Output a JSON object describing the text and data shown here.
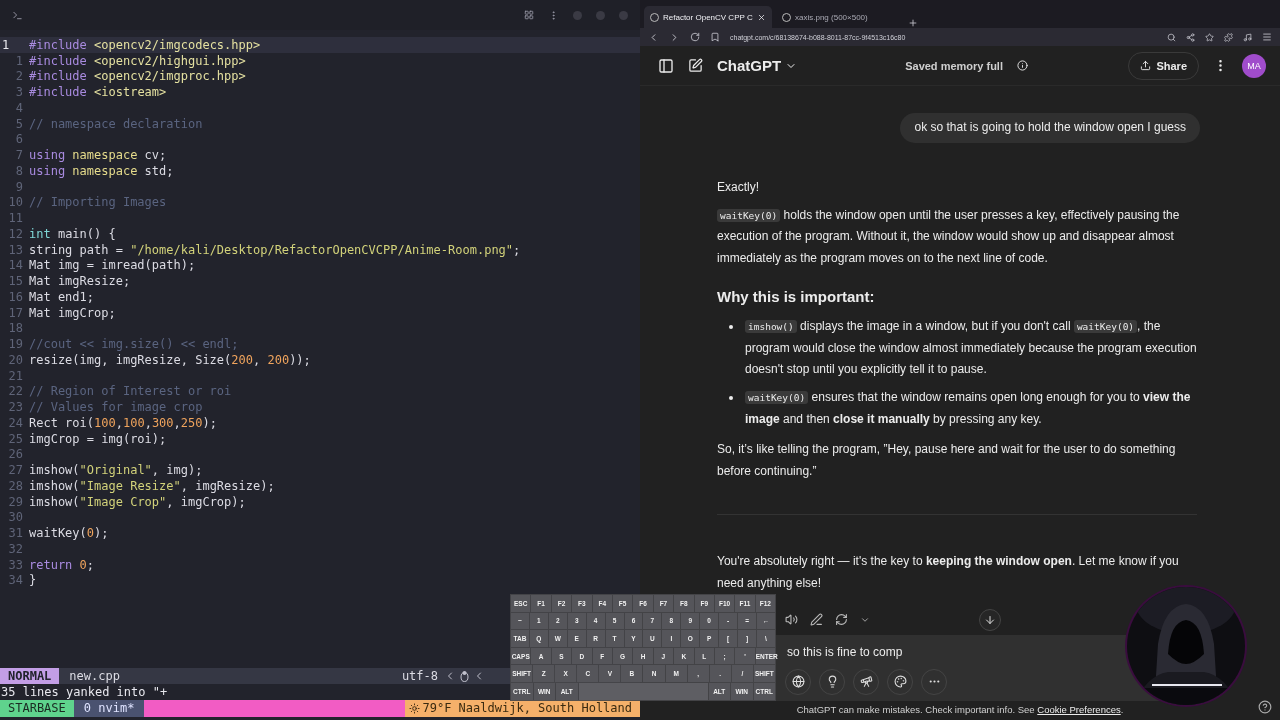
{
  "editor": {
    "lines": [
      {
        "number": "1",
        "current": true,
        "tokens": [
          {
            "kind": "pre",
            "text": "#include "
          },
          {
            "kind": "header",
            "text": "<opencv2/imgcodecs.hpp>"
          }
        ]
      },
      {
        "number": "1",
        "current": false,
        "tokens": [
          {
            "kind": "pre",
            "text": "#include "
          },
          {
            "kind": "header",
            "text": "<opencv2/highgui.hpp>"
          }
        ]
      },
      {
        "number": "2",
        "current": false,
        "tokens": [
          {
            "kind": "pre",
            "text": "#include "
          },
          {
            "kind": "header",
            "text": "<opencv2/imgproc.hpp>"
          }
        ]
      },
      {
        "number": "3",
        "current": false,
        "tokens": [
          {
            "kind": "pre",
            "text": "#include "
          },
          {
            "kind": "header",
            "text": "<iostream>"
          }
        ]
      },
      {
        "number": "4",
        "current": false
      },
      {
        "number": "5",
        "current": false,
        "tokens": [
          {
            "kind": "comment",
            "text": "// namespace declaration"
          }
        ]
      },
      {
        "number": "6",
        "current": false
      },
      {
        "number": "7",
        "current": false,
        "tokens": [
          {
            "kind": "kw",
            "text": "using "
          },
          {
            "kind": "type",
            "text": "namespace"
          },
          {
            "kind": "plain",
            "text": " cv;"
          }
        ]
      },
      {
        "number": "8",
        "current": false,
        "tokens": [
          {
            "kind": "kw",
            "text": "using "
          },
          {
            "kind": "type",
            "text": "namespace"
          },
          {
            "kind": "plain",
            "text": " std;"
          }
        ]
      },
      {
        "number": "9",
        "current": false
      },
      {
        "number": "10",
        "current": false,
        "tokens": [
          {
            "kind": "comment",
            "text": "// Importing Images"
          }
        ]
      },
      {
        "number": "11",
        "current": false
      },
      {
        "number": "12",
        "current": false,
        "tokens": [
          {
            "kind": "type2",
            "text": "int"
          },
          {
            "kind": "plain",
            "text": " main() {"
          }
        ]
      },
      {
        "number": "13",
        "current": false,
        "tokens": [
          {
            "kind": "plain",
            "text": "string path = "
          },
          {
            "kind": "string",
            "text": "\"/home/kali/Desktop/RefactorOpenCVCPP/Anime-Room.png\""
          },
          {
            "kind": "plain",
            "text": ";"
          }
        ]
      },
      {
        "number": "14",
        "current": false,
        "tokens": [
          {
            "kind": "plain",
            "text": "Mat img = imread(path);"
          }
        ]
      },
      {
        "number": "15",
        "current": false,
        "tokens": [
          {
            "kind": "plain",
            "text": "Mat imgResize;"
          }
        ]
      },
      {
        "number": "16",
        "current": false,
        "tokens": [
          {
            "kind": "plain",
            "text": "Mat end1;"
          }
        ]
      },
      {
        "number": "17",
        "current": false,
        "tokens": [
          {
            "kind": "plain",
            "text": "Mat imgCrop;"
          }
        ]
      },
      {
        "number": "18",
        "current": false
      },
      {
        "number": "19",
        "current": false,
        "tokens": [
          {
            "kind": "comment",
            "text": "//cout << img.size() << endl;"
          }
        ]
      },
      {
        "number": "20",
        "current": false,
        "tokens": [
          {
            "kind": "plain",
            "text": "resize(img, imgResize, Size("
          },
          {
            "kind": "num",
            "text": "200"
          },
          {
            "kind": "plain",
            "text": ", "
          },
          {
            "kind": "num",
            "text": "200"
          },
          {
            "kind": "plain",
            "text": "));"
          }
        ]
      },
      {
        "number": "21",
        "current": false
      },
      {
        "number": "22",
        "current": false,
        "tokens": [
          {
            "kind": "comment",
            "text": "// Region of Interest or roi"
          }
        ]
      },
      {
        "number": "23",
        "current": false,
        "tokens": [
          {
            "kind": "comment",
            "text": "// Values for image crop"
          }
        ]
      },
      {
        "number": "24",
        "current": false,
        "tokens": [
          {
            "kind": "plain",
            "text": "Rect roi("
          },
          {
            "kind": "num",
            "text": "100"
          },
          {
            "kind": "plain",
            "text": ","
          },
          {
            "kind": "num",
            "text": "100"
          },
          {
            "kind": "plain",
            "text": ","
          },
          {
            "kind": "num",
            "text": "300"
          },
          {
            "kind": "plain",
            "text": ","
          },
          {
            "kind": "num",
            "text": "250"
          },
          {
            "kind": "plain",
            "text": ");"
          }
        ]
      },
      {
        "number": "25",
        "current": false,
        "tokens": [
          {
            "kind": "plain",
            "text": "imgCrop = img(roi);"
          }
        ]
      },
      {
        "number": "26",
        "current": false
      },
      {
        "number": "27",
        "current": false,
        "tokens": [
          {
            "kind": "plain",
            "text": "imshow("
          },
          {
            "kind": "string",
            "text": "\"Original\""
          },
          {
            "kind": "plain",
            "text": ", img);"
          }
        ]
      },
      {
        "number": "28",
        "current": false,
        "tokens": [
          {
            "kind": "plain",
            "text": "imshow("
          },
          {
            "kind": "string",
            "text": "\"Image Resize\""
          },
          {
            "kind": "plain",
            "text": ", imgResize);"
          }
        ]
      },
      {
        "number": "29",
        "current": false,
        "tokens": [
          {
            "kind": "plain",
            "text": "imshow("
          },
          {
            "kind": "string",
            "text": "\"Image Crop\""
          },
          {
            "kind": "plain",
            "text": ", imgCrop);"
          }
        ]
      },
      {
        "number": "30",
        "current": false
      },
      {
        "number": "31",
        "current": false,
        "tokens": [
          {
            "kind": "plain",
            "text": "waitKey("
          },
          {
            "kind": "num",
            "text": "0"
          },
          {
            "kind": "plain",
            "text": ");"
          }
        ]
      },
      {
        "number": "32",
        "current": false
      },
      {
        "number": "33",
        "current": false,
        "tokens": [
          {
            "kind": "kw",
            "text": "return "
          },
          {
            "kind": "num",
            "text": "0"
          },
          {
            "kind": "plain",
            "text": ";"
          }
        ]
      },
      {
        "number": "34",
        "current": false,
        "tokens": [
          {
            "kind": "plain",
            "text": "}"
          }
        ]
      }
    ],
    "statusline": {
      "mode": "NORMAL",
      "file": "new.cpp",
      "encoding": "utf-8"
    },
    "message": "35 lines yanked into \"+",
    "tmux": {
      "session": "STARBASE",
      "window": "0 nvim*",
      "weather": "79°F Naaldwijk, South Holland"
    }
  },
  "browser": {
    "tabs": [
      {
        "label": "Refactor OpenCV CPP C",
        "selected": true
      },
      {
        "label": "xaxis.png (500×500)",
        "selected": false
      }
    ],
    "url": "chatgpt.com/c/68138674-b088-8011-87cc-9f4513c16c80"
  },
  "chat": {
    "title": "ChatGPT",
    "memory_notice": "Saved memory full",
    "share": "Share",
    "avatar": "MA",
    "messages": [
      {
        "kind": "user",
        "text": "ok so that is going to hold the window open I guess"
      },
      {
        "kind": "assistant",
        "blocks": [
          {
            "kind": "p",
            "parts": [
              {
                "kind": "text",
                "text": "Exactly!"
              }
            ]
          },
          {
            "kind": "p",
            "parts": [
              {
                "kind": "code",
                "text": "waitKey(0)"
              },
              {
                "kind": "text",
                "text": " holds the window open until the user presses a key, effectively pausing the execution of the program. Without it, the window would show up and disappear almost immediately as the program moves on to the next line of code."
              }
            ]
          },
          {
            "kind": "h",
            "text": "Why this is important:"
          },
          {
            "kind": "ul",
            "items": [
              [
                {
                  "kind": "code",
                  "text": "imshow()"
                },
                {
                  "kind": "text",
                  "text": " displays the image in a window, but if you don't call "
                },
                {
                  "kind": "code",
                  "text": "waitKey(0)"
                },
                {
                  "kind": "text",
                  "text": ", the program would close the window almost immediately because the program execution doesn't stop until you explicitly tell it to pause."
                }
              ],
              [
                {
                  "kind": "code",
                  "text": "waitKey(0)"
                },
                {
                  "kind": "text",
                  "text": " ensures that the window remains open long enough for you to **view the image** and then **close it manually** by pressing any key."
                }
              ]
            ]
          },
          {
            "kind": "p",
            "parts": [
              {
                "kind": "text",
                "text": "So, it’s like telling the program, ”Hey, pause here and wait for the user to do something before continuing.”"
              }
            ]
          },
          {
            "kind": "hr"
          }
        ]
      },
      {
        "kind": "assistant",
        "blocks": [
          {
            "kind": "p",
            "parts": [
              {
                "kind": "text",
                "text": "You're absolutely right — it's the key to **keeping the window open**. Let me know if you need anything else!"
              }
            ]
          }
        ]
      }
    ],
    "composer": {
      "value": "so this is fine to comp"
    },
    "footer": {
      "text": "ChatGPT can make mistakes. Check important info. See ",
      "link": "Cookie Preferences",
      "end": "."
    }
  },
  "keyboard": {
    "keys": [
      {
        "kind": "key",
        "label": "ESC"
      },
      {
        "kind": "key",
        "label": "F1"
      },
      {
        "kind": "key",
        "label": "F2"
      },
      {
        "kind": "key",
        "label": "F3"
      },
      {
        "kind": "key",
        "label": "F4"
      },
      {
        "kind": "key",
        "label": "F5"
      },
      {
        "kind": "key",
        "label": "F6"
      },
      {
        "kind": "key",
        "label": "F7"
      },
      {
        "kind": "key",
        "label": "F8"
      },
      {
        "kind": "key",
        "label": "F9"
      },
      {
        "kind": "key",
        "label": "F10"
      },
      {
        "kind": "key",
        "label": "F11"
      },
      {
        "kind": "key",
        "label": "F12"
      },
      {
        "kind": "break"
      },
      {
        "kind": "key",
        "label": "~"
      },
      {
        "kind": "key",
        "label": "1"
      },
      {
        "kind": "key",
        "label": "2"
      },
      {
        "kind": "key",
        "label": "3"
      },
      {
        "kind": "key",
        "label": "4"
      },
      {
        "kind": "key",
        "label": "5"
      },
      {
        "kind": "key",
        "label": "6"
      },
      {
        "kind": "key",
        "label": "7"
      },
      {
        "kind": "key",
        "label": "8"
      },
      {
        "kind": "key",
        "label": "9"
      },
      {
        "kind": "key",
        "label": "0"
      },
      {
        "kind": "key",
        "label": "-"
      },
      {
        "kind": "key",
        "label": "="
      },
      {
        "kind": "key",
        "label": "←"
      },
      {
        "kind": "break"
      },
      {
        "kind": "key",
        "label": "TAB"
      },
      {
        "kind": "key",
        "label": "Q"
      },
      {
        "kind": "key",
        "label": "W"
      },
      {
        "kind": "key",
        "label": "E"
      },
      {
        "kind": "key",
        "label": "R"
      },
      {
        "kind": "key",
        "label": "T"
      },
      {
        "kind": "key",
        "label": "Y"
      },
      {
        "kind": "key",
        "label": "U"
      },
      {
        "kind": "key",
        "label": "I"
      },
      {
        "kind": "key",
        "label": "O"
      },
      {
        "kind": "key",
        "label": "P"
      },
      {
        "kind": "key",
        "label": "["
      },
      {
        "kind": "key",
        "label": "]"
      },
      {
        "kind": "key",
        "label": "\\"
      },
      {
        "kind": "break"
      },
      {
        "kind": "key",
        "label": "CAPS"
      },
      {
        "kind": "key",
        "label": "A"
      },
      {
        "kind": "key",
        "label": "S"
      },
      {
        "kind": "key",
        "label": "D"
      },
      {
        "kind": "key",
        "label": "F"
      },
      {
        "kind": "key",
        "label": "G"
      },
      {
        "kind": "key",
        "label": "H"
      },
      {
        "kind": "key",
        "label": "J"
      },
      {
        "kind": "key",
        "label": "K"
      },
      {
        "kind": "key",
        "label": "L"
      },
      {
        "kind": "key",
        "label": ";"
      },
      {
        "kind": "key",
        "label": "'"
      },
      {
        "kind": "key",
        "label": "ENTER"
      },
      {
        "kind": "break"
      },
      {
        "kind": "key",
        "label": "SHIFT"
      },
      {
        "kind": "key",
        "label": "Z"
      },
      {
        "kind": "key",
        "label": "X"
      },
      {
        "kind": "key",
        "label": "C"
      },
      {
        "kind": "key",
        "label": "V"
      },
      {
        "kind": "key",
        "label": "B"
      },
      {
        "kind": "key",
        "label": "N"
      },
      {
        "kind": "key",
        "label": "M"
      },
      {
        "kind": "key",
        "label": ","
      },
      {
        "kind": "key",
        "label": "."
      },
      {
        "kind": "key",
        "label": "/"
      },
      {
        "kind": "key",
        "label": "SHIFT"
      },
      {
        "kind": "break"
      },
      {
        "kind": "key",
        "label": "CTRL"
      },
      {
        "kind": "key",
        "label": "WIN"
      },
      {
        "kind": "key",
        "label": "ALT"
      },
      {
        "kind": "space"
      },
      {
        "kind": "key",
        "label": "ALT"
      },
      {
        "kind": "key",
        "label": "WIN"
      },
      {
        "kind": "key",
        "label": "CTRL"
      }
    ]
  }
}
